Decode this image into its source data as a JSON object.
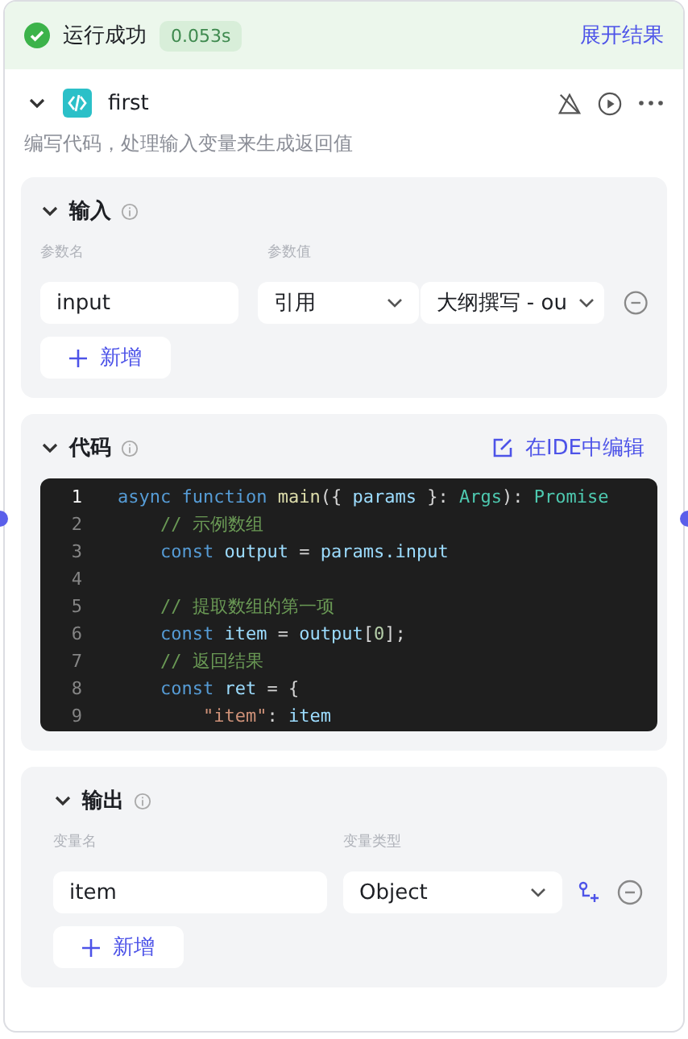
{
  "status_bar": {
    "label": "运行成功",
    "duration": "0.053s",
    "action": "展开结果"
  },
  "node": {
    "title": "first",
    "expanded": true,
    "description": "编写代码，处理输入变量来生成返回值"
  },
  "input_section": {
    "title": "输入",
    "expanded": true,
    "columns": [
      "参数名",
      "参数值"
    ],
    "rows": [
      {
        "name": "input",
        "source": "引用",
        "value": "大纲撰写 - ou"
      }
    ],
    "add_button": "新增"
  },
  "code_section": {
    "title": "代码",
    "expanded": true,
    "edit_link": "在IDE中编辑",
    "lines": [
      {
        "number": "1",
        "active": true,
        "tokens": [
          {
            "kind": "keyword",
            "text": "async function "
          },
          {
            "kind": "function",
            "text": "main"
          },
          {
            "kind": "plain",
            "text": "({ "
          },
          {
            "kind": "variable",
            "text": "params"
          },
          {
            "kind": "plain",
            "text": " }: "
          },
          {
            "kind": "type",
            "text": "Args"
          },
          {
            "kind": "plain",
            "text": "): "
          },
          {
            "kind": "type",
            "text": "Promise"
          }
        ]
      },
      {
        "number": "2",
        "active": false,
        "tokens": [
          {
            "kind": "comment",
            "text": "    // 示例数组"
          }
        ]
      },
      {
        "number": "3",
        "active": false,
        "tokens": [
          {
            "kind": "keyword",
            "text": "    const "
          },
          {
            "kind": "variable",
            "text": "output"
          },
          {
            "kind": "plain",
            "text": " = "
          },
          {
            "kind": "variable",
            "text": "params.input"
          }
        ]
      },
      {
        "number": "4",
        "active": false
      },
      {
        "number": "5",
        "active": false,
        "tokens": [
          {
            "kind": "comment",
            "text": "    // 提取数组的第一项"
          }
        ]
      },
      {
        "number": "6",
        "active": false,
        "tokens": [
          {
            "kind": "keyword",
            "text": "    const "
          },
          {
            "kind": "variable",
            "text": "item"
          },
          {
            "kind": "plain",
            "text": " = "
          },
          {
            "kind": "variable",
            "text": "output"
          },
          {
            "kind": "plain",
            "text": "["
          },
          {
            "kind": "number",
            "text": "0"
          },
          {
            "kind": "plain",
            "text": "];"
          }
        ]
      },
      {
        "number": "7",
        "active": false,
        "tokens": [
          {
            "kind": "comment",
            "text": "    // 返回结果"
          }
        ]
      },
      {
        "number": "8",
        "active": false,
        "tokens": [
          {
            "kind": "keyword",
            "text": "    const "
          },
          {
            "kind": "variable",
            "text": "ret"
          },
          {
            "kind": "plain",
            "text": " = {"
          }
        ]
      },
      {
        "number": "9",
        "active": false,
        "tokens": [
          {
            "kind": "string",
            "text": "        \"item\""
          },
          {
            "kind": "plain",
            "text": ": "
          },
          {
            "kind": "variable",
            "text": "item"
          }
        ]
      }
    ]
  },
  "output_section": {
    "title": "输出",
    "expanded": true,
    "columns": [
      "变量名",
      "变量类型"
    ],
    "rows": [
      {
        "name": "item",
        "type": "Object"
      }
    ],
    "add_button": "新增"
  }
}
